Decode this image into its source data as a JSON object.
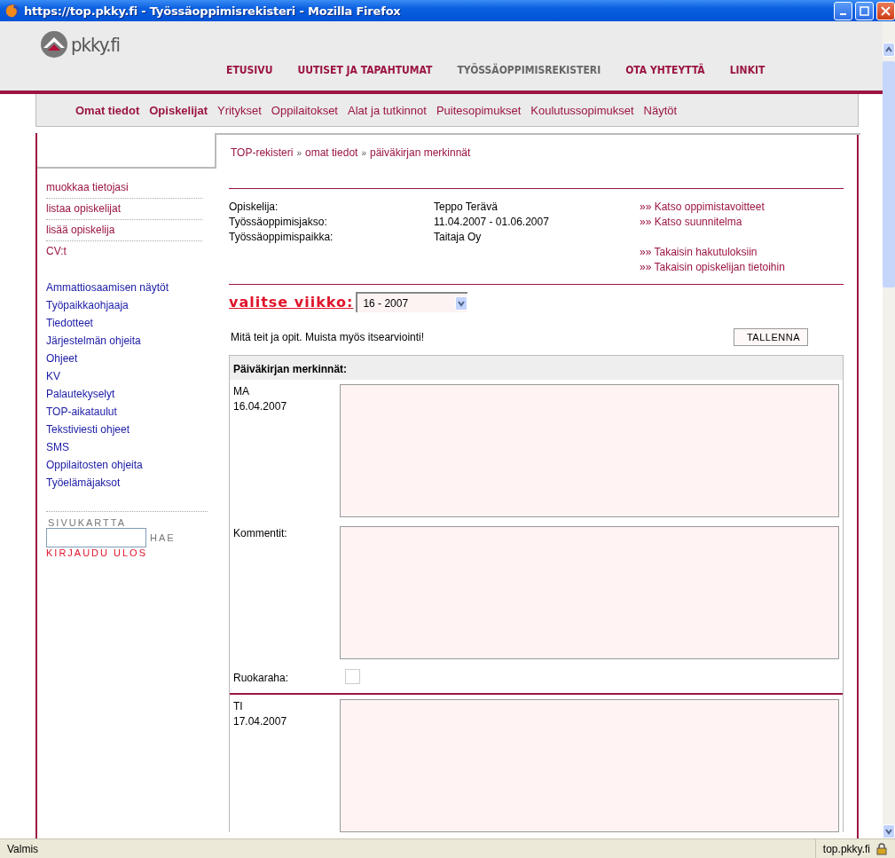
{
  "window": {
    "title": "https://top.pkky.fi - Työssäoppimisrekisteri - Mozilla Firefox"
  },
  "header": {
    "logo": "pkky.fi",
    "nav": [
      {
        "label": "ETUSIVU",
        "selected": false
      },
      {
        "label": "UUTISET JA TAPAHTUMAT",
        "selected": false
      },
      {
        "label": "TYÖSSÄOPPIMISREKISTERI",
        "selected": true
      },
      {
        "label": "OTA YHTEYTTÄ",
        "selected": false
      },
      {
        "label": "LINKIT",
        "selected": false
      }
    ]
  },
  "subnav": [
    {
      "label": "Omat tiedot",
      "selected": true
    },
    {
      "label": "Opiskelijat",
      "selected": true
    },
    {
      "label": "Yritykset",
      "selected": false
    },
    {
      "label": "Oppilaitokset",
      "selected": false
    },
    {
      "label": "Alat ja tutkinnot",
      "selected": false
    },
    {
      "label": "Puitesopimukset",
      "selected": false
    },
    {
      "label": "Koulutussopimukset",
      "selected": false
    },
    {
      "label": "Näytöt",
      "selected": false
    }
  ],
  "sidebar": {
    "account_links": [
      "muokkaa tietojasi",
      "listaa opiskelijat",
      "lisää opiskelija",
      "CV:t"
    ],
    "info_links": [
      "Ammattiosaamisen näytöt",
      "Työpaikkaohjaaja",
      "Tiedotteet",
      "Järjestelmän ohjeita",
      "Ohjeet",
      "KV",
      "Palautekyselyt",
      "TOP-aikataulut",
      "Tekstiviesti ohjeet",
      "SMS",
      "Oppilaitosten ohjeita",
      "Työelämäjaksot"
    ],
    "sitemap": {
      "label": "SIVUKARTTA",
      "search_button": "HAE",
      "logout": "KIRJAUDU ULOS"
    }
  },
  "breadcrumb": {
    "separator": "»",
    "items": [
      "TOP-rekisteri",
      "omat tiedot",
      "päiväkirjan merkinnät"
    ]
  },
  "student_info": {
    "rows": [
      {
        "label": "Opiskelija:",
        "value": "Teppo Terävä"
      },
      {
        "label": "Työssäoppimisjakso:",
        "value": "11.04.2007 - 01.06.2007"
      },
      {
        "label": "Työssäoppimispaikka:",
        "value": "Taitaja Oy"
      }
    ],
    "link_marker": "»»",
    "link_groups": [
      [
        "Katso oppimistavoitteet",
        "Katso suunnitelma"
      ],
      [
        "Takaisin hakutuloksiin",
        "Takaisin opiskelijan tietoihin"
      ]
    ]
  },
  "week_select": {
    "label": "valitse viikko:",
    "value": "16 - 2007"
  },
  "instructions": "Mitä teit ja opit. Muista myös itsearviointi!",
  "save_button": "TALLENNA",
  "diary": {
    "title": "Päiväkirjan merkinnät:",
    "days": [
      {
        "day": "MA",
        "date": "16.04.2007",
        "comment_label": "Kommentit:",
        "allowance_label": "Ruokaraha:",
        "allowance_checked": false
      },
      {
        "day": "TI",
        "date": "17.04.2007"
      }
    ]
  },
  "status_bar": {
    "text": "Valmis",
    "host": "top.pkky.fi"
  }
}
